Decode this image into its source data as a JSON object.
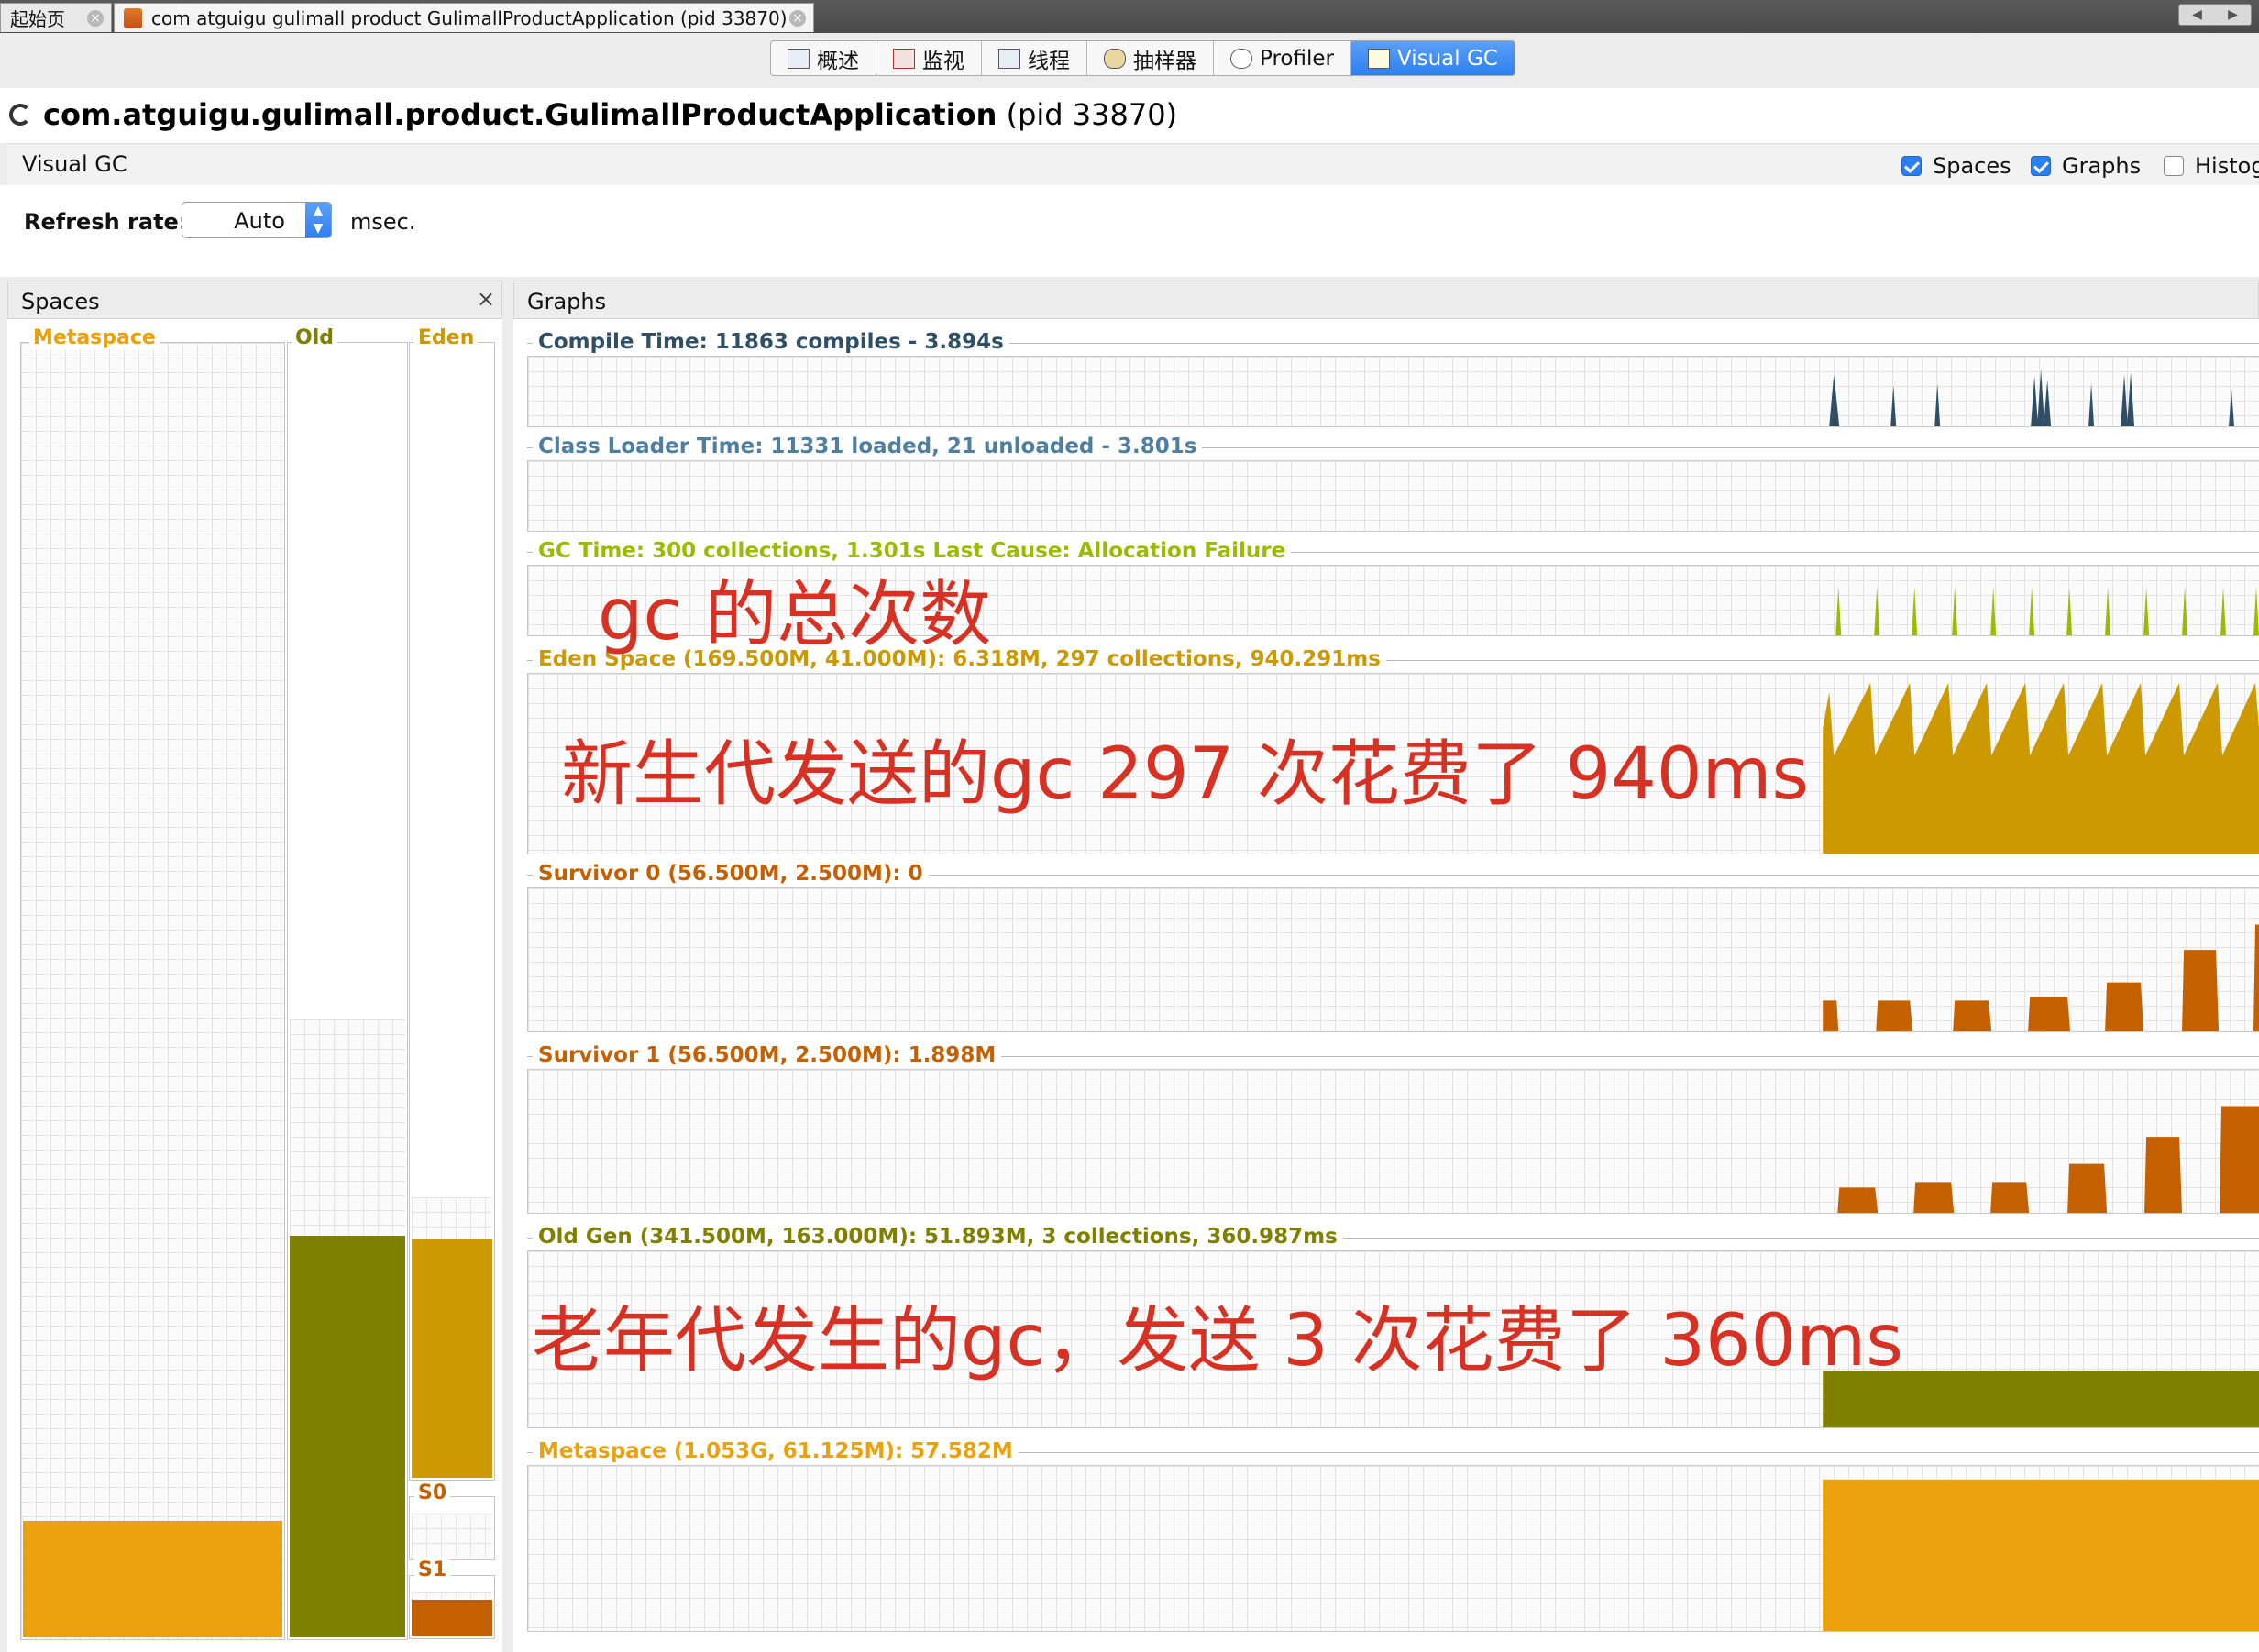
{
  "tabs": {
    "home_label": "起始页",
    "app_tab_label": "com atguigu gulimall product GulimallProductApplication (pid 33870)"
  },
  "view_tabs": [
    {
      "label": "概述",
      "icon": "overview-icon"
    },
    {
      "label": "监视",
      "icon": "monitor-icon"
    },
    {
      "label": "线程",
      "icon": "threads-icon"
    },
    {
      "label": "抽样器",
      "icon": "sampler-icon"
    },
    {
      "label": "Profiler",
      "icon": "profiler-icon"
    },
    {
      "label": "Visual GC",
      "icon": "visual-gc-icon",
      "active": true
    }
  ],
  "title": {
    "app_name": "com.atguigu.gulimall.product.GulimallProductApplication",
    "pid": "(pid 33870)"
  },
  "visual_gc": {
    "title": "Visual GC",
    "options": [
      {
        "label": "Spaces",
        "checked": true
      },
      {
        "label": "Graphs",
        "checked": true
      },
      {
        "label": "Histog",
        "checked": false
      }
    ]
  },
  "refresh": {
    "label": "Refresh rate:",
    "value": "Auto",
    "unit": "msec."
  },
  "spaces_panel": {
    "title": "Spaces",
    "close": "×",
    "metaspace": {
      "label": "Metaspace",
      "color": "#eba10c",
      "fill": 0.09
    },
    "old": {
      "label": "Old",
      "color": "#7f7f00",
      "fill": 0.31
    },
    "eden": {
      "label": "Eden",
      "color": "#cc9900",
      "fill": 0.21
    },
    "s0": {
      "label": "S0",
      "color": "#c46000",
      "fill": 0.0
    },
    "s1": {
      "label": "S1",
      "color": "#c46000",
      "fill": 0.6
    }
  },
  "graphs_panel": {
    "title": "Graphs",
    "graphs": [
      {
        "title": "Compile Time: 11863 compiles - 3.894s",
        "color": "#2f4f66"
      },
      {
        "title": "Class Loader Time: 11331 loaded, 21 unloaded - 3.801s",
        "color": "#4f7fa0"
      },
      {
        "title": "GC Time: 300 collections, 1.301s  Last Cause: Allocation Failure",
        "color": "#99bb00"
      },
      {
        "title": "Eden Space (169.500M, 41.000M): 6.318M, 297 collections, 940.291ms",
        "color": "#cc9900"
      },
      {
        "title": "Survivor 0 (56.500M, 2.500M): 0",
        "color": "#c46000"
      },
      {
        "title": "Survivor 1 (56.500M, 2.500M): 1.898M",
        "color": "#c46000"
      },
      {
        "title": "Old Gen (341.500M, 163.000M): 51.893M, 3 collections, 360.987ms",
        "color": "#7f7f00"
      },
      {
        "title": "Metaspace (1.053G, 61.125M): 57.582M",
        "color": "#eba10c"
      }
    ]
  },
  "annotations": {
    "gc_total": "gc 的总次数",
    "young_gc": "新生代发送的gc 297 次花费了 940ms",
    "old_gc": "老年代发生的gc，发送 3 次花费了 360ms"
  }
}
